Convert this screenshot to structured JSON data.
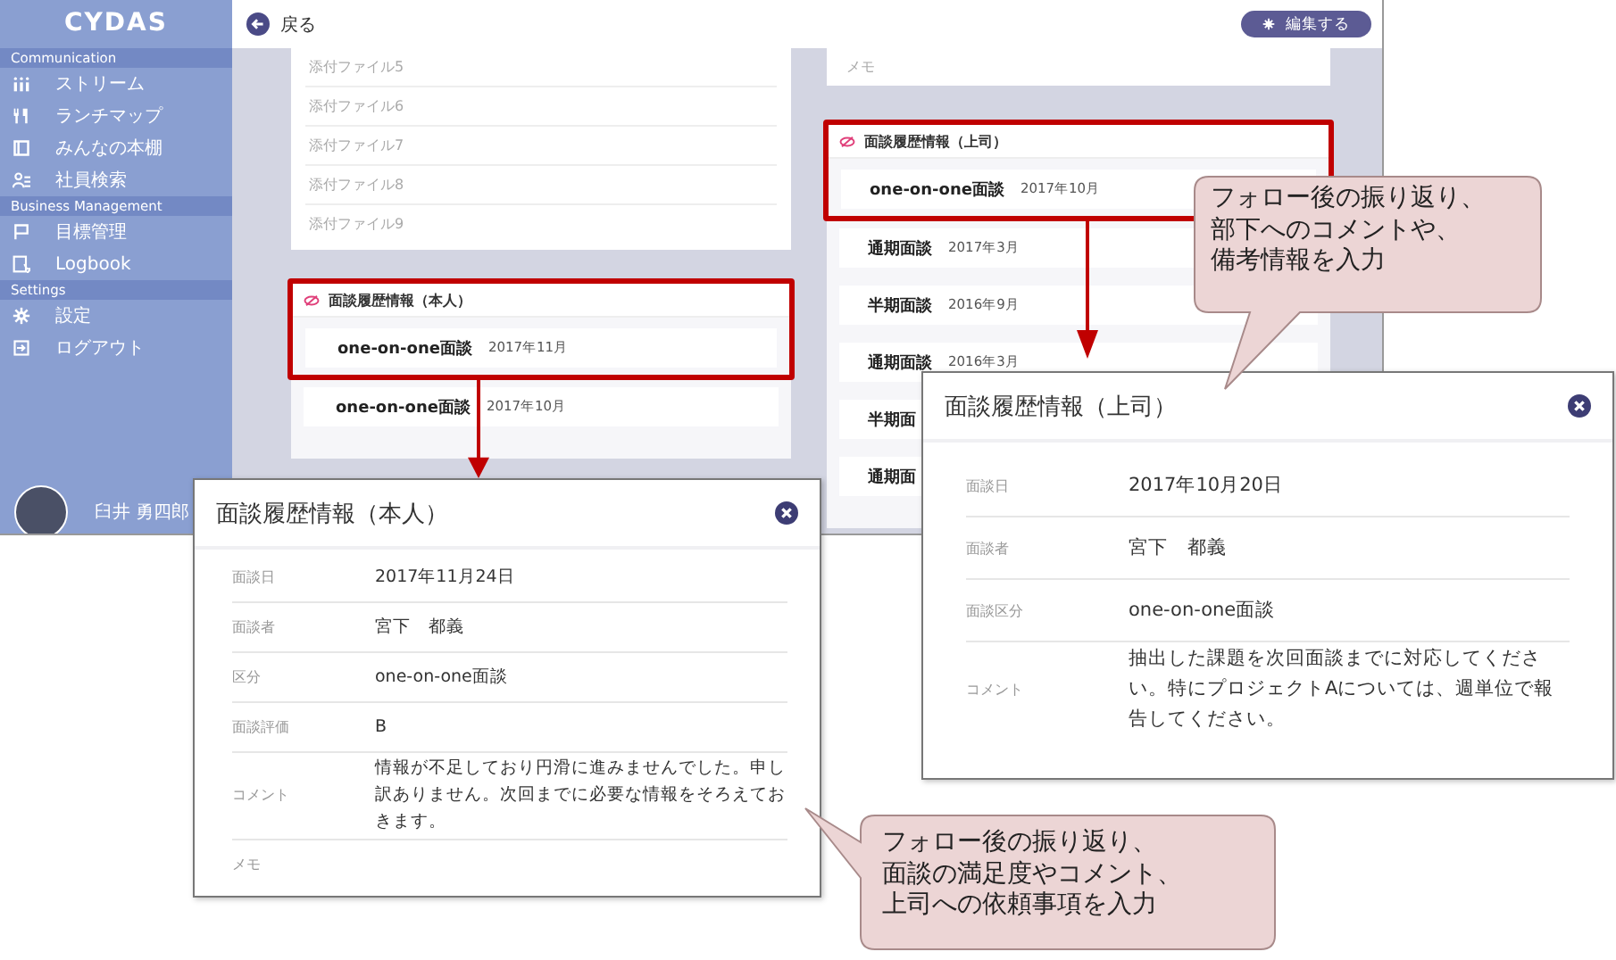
{
  "sidebar": {
    "logo": "CYDAS",
    "sections": [
      {
        "title": "Communication",
        "items": [
          "ストリーム",
          "ランチマップ",
          "みんなの本棚",
          "社員検索"
        ]
      },
      {
        "title": "Business Management",
        "items": [
          "目標管理",
          "Logbook"
        ]
      },
      {
        "title": "Settings",
        "items": [
          "設定",
          "ログアウト"
        ]
      }
    ],
    "user": {
      "name": "臼井 勇四郎"
    }
  },
  "header": {
    "back": "戻る",
    "edit": "編集する"
  },
  "left_column": {
    "attachments": [
      "添付ファイル5",
      "添付ファイル6",
      "添付ファイル7",
      "添付ファイル8",
      "添付ファイル9"
    ],
    "history": {
      "title": "面談履歴情報（本人）",
      "items": [
        {
          "type": "one-on-one面談",
          "date": "2017年11月"
        },
        {
          "type": "one-on-one面談",
          "date": "2017年10月"
        }
      ]
    }
  },
  "right_column": {
    "memo": "メモ",
    "history": {
      "title": "面談履歴情報（上司）",
      "items": [
        {
          "type": "one-on-one面談",
          "date": "2017年10月"
        },
        {
          "type": "通期面談",
          "date": "2017年3月"
        },
        {
          "type": "半期面談",
          "date": "2016年9月"
        },
        {
          "type": "通期面談",
          "date": "2016年3月"
        },
        {
          "type": "半期面"
        },
        {
          "type": "通期面"
        }
      ]
    }
  },
  "dialogs": [
    {
      "title": "面談履歴情報（本人）",
      "fields": [
        {
          "label": "面談日",
          "value": "2017年11月24日"
        },
        {
          "label": "面談者",
          "value": "宮下　都義"
        },
        {
          "label": "区分",
          "value": "one-on-one面談"
        },
        {
          "label": "面談評価",
          "value": "B"
        },
        {
          "label": "コメント",
          "value": "情報が不足しており円滑に進みませんでした。申し訳ありません。次回までに必要な情報をそろえておきます。"
        },
        {
          "label": "メモ"
        }
      ]
    },
    {
      "title": "面談履歴情報（上司）",
      "fields": [
        {
          "label": "面談日",
          "value": "2017年10月20日"
        },
        {
          "label": "面談者",
          "value": "宮下　都義"
        },
        {
          "label": "面談区分",
          "value": "one-on-one面談"
        },
        {
          "label": "コメント",
          "value": "抽出した課題を次回面談までに対応してください。特にプロジェクトAについては、週単位で報告してください。"
        }
      ]
    }
  ],
  "callouts": [
    {
      "lines": [
        "フォロー後の振り返り、",
        "部下へのコメントや、",
        "備考情報を入力"
      ]
    },
    {
      "lines": [
        "フォロー後の振り返り、",
        "面談の満足度やコメント、",
        "上司への依頼事項を入力"
      ]
    }
  ]
}
